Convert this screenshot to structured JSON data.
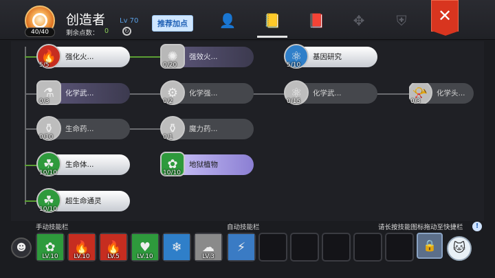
{
  "header": {
    "hp": "40/40",
    "name": "创造者",
    "level": "Lv 70",
    "points_label": "剩余点数：",
    "points_value": "0",
    "recommend_button": "推荐加点"
  },
  "tabs": [
    {
      "name": "character-tab",
      "icon": "user-star-icon",
      "glyph": "👤"
    },
    {
      "name": "skills-tab",
      "icon": "contact-book-icon",
      "glyph": "📒",
      "selected": true
    },
    {
      "name": "book-tab",
      "icon": "book-icon",
      "glyph": "📕"
    },
    {
      "name": "move-tab",
      "icon": "cross-arrows-icon",
      "glyph": "✥"
    },
    {
      "name": "guild-tab",
      "icon": "winged-shield-icon",
      "glyph": "⛨"
    }
  ],
  "close_glyph": "✕",
  "skill_tree": [
    {
      "label": "强化火...",
      "count": "5/5",
      "style": "white",
      "icon": "fire-orb-icon",
      "color": "#c62d20",
      "glyph": "🔥",
      "round": true
    },
    {
      "label": "强效火...",
      "count": "0/20",
      "style": "purple",
      "icon": "flame-burst-icon",
      "color": "#b8b8b8",
      "glyph": "✺",
      "round": false
    },
    {
      "label": "基因研究",
      "count": "5/10",
      "style": "white",
      "icon": "molecule-icon",
      "color": "#2f7fc9",
      "glyph": "⚛",
      "round": true
    },
    {
      "label": "化学武...",
      "count": "0/3",
      "style": "purple",
      "icon": "flask-icon",
      "color": "#bdbdbd",
      "glyph": "⚗",
      "round": false
    },
    {
      "label": "化学强...",
      "count": "0/2",
      "style": "gray",
      "icon": "gear-drop-icon",
      "color": "#bdbdbd",
      "glyph": "⚙",
      "round": true
    },
    {
      "label": "化学武...",
      "count": "0/15",
      "style": "gray",
      "icon": "molecule-icon",
      "color": "#bdbdbd",
      "glyph": "⚛",
      "round": true
    },
    {
      "label": "化学头...",
      "count": "0/3",
      "style": "gray",
      "icon": "horn-icon",
      "color": "#bdbdbd",
      "glyph": "📯",
      "round": true
    },
    {
      "label": "生命药...",
      "count": "0/10",
      "style": "gray",
      "icon": "potion-icon",
      "color": "#bdbdbd",
      "glyph": "⚱",
      "round": true
    },
    {
      "label": "魔力药...",
      "count": "0/1",
      "style": "gray",
      "icon": "potion-icon",
      "color": "#bdbdbd",
      "glyph": "⚱",
      "round": true
    },
    {
      "label": "生命体...",
      "count": "10/10",
      "style": "white",
      "icon": "life-form-icon",
      "color": "#2e9a3c",
      "glyph": "☘",
      "round": true
    },
    {
      "label": "地狱植物",
      "count": "10/10",
      "style": "lilac",
      "icon": "hell-plant-icon",
      "color": "#2e9a3c",
      "glyph": "✿",
      "round": false
    },
    {
      "label": "超生命通灵",
      "count": "10/10",
      "style": "white",
      "icon": "spirit-summon-icon",
      "color": "#2e9a3c",
      "glyph": "☘",
      "round": true
    }
  ],
  "bottom": {
    "manual_label": "手动技能栏",
    "auto_label": "自动技能栏",
    "hint": "请长按技能图标拖动至快捷栏",
    "info_glyph": "!",
    "manual_slots": [
      {
        "level": "LV.10",
        "icon": "plant-summon-icon",
        "color": "#2e9a3c",
        "glyph": "✿"
      },
      {
        "level": "LV.10",
        "icon": "fire-blast-icon",
        "color": "#c62d20",
        "glyph": "🔥"
      },
      {
        "level": "LV.5",
        "icon": "fire-ring-icon",
        "color": "#c62d20",
        "glyph": "🔥"
      },
      {
        "level": "LV.10",
        "icon": "heart-heal-icon",
        "color": "#2e9a3c",
        "glyph": "♥"
      },
      {
        "level": "",
        "icon": "ice-burst-icon",
        "color": "#2f7fc9",
        "glyph": "❄"
      },
      {
        "level": "LV.3",
        "icon": "smoke-icon",
        "color": "#8a8a8a",
        "glyph": "☁"
      }
    ],
    "auto_slots": [
      {
        "level": "",
        "icon": "lightning-strike-icon",
        "color": "#3a7bc4",
        "glyph": "⚡"
      },
      {
        "level": "",
        "icon": "",
        "color": "",
        "glyph": ""
      },
      {
        "level": "",
        "icon": "",
        "color": "",
        "glyph": ""
      },
      {
        "level": "",
        "icon": "",
        "color": "",
        "glyph": ""
      },
      {
        "level": "",
        "icon": "",
        "color": "",
        "glyph": ""
      },
      {
        "level": "",
        "icon": "",
        "color": "",
        "glyph": ""
      }
    ],
    "lock_glyph": "🔒",
    "pet_left_glyph": "☻",
    "pet_right_glyph": "🐱"
  }
}
